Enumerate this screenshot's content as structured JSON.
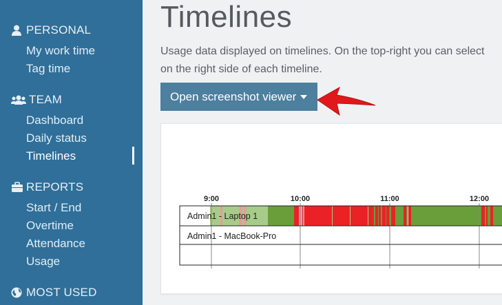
{
  "sidebar": {
    "sections": [
      {
        "label": "PERSONAL",
        "icon": "user-icon",
        "items": [
          "My work time",
          "Tag time"
        ]
      },
      {
        "label": "TEAM",
        "icon": "users-icon",
        "items": [
          "Dashboard",
          "Daily status",
          "Timelines"
        ]
      },
      {
        "label": "REPORTS",
        "icon": "briefcase-icon",
        "items": [
          "Start / End",
          "Overtime",
          "Attendance",
          "Usage"
        ]
      },
      {
        "label": "MOST USED",
        "icon": "globe-icon",
        "items": []
      }
    ],
    "active_item": "Timelines"
  },
  "main": {
    "title": "Timelines",
    "description_line1": "Usage data displayed on timelines. On the top-right you can select",
    "description_line2": "on the right side of each timeline.",
    "viewer_button": "Open screenshot viewer"
  },
  "timeline": {
    "hours": [
      "9:00",
      "10:00",
      "11:00",
      "12:00"
    ],
    "rows": [
      {
        "label": "Admin1 - Laptop 1"
      },
      {
        "label": "Admin1 - MacBook-Pro"
      },
      {
        "label": ""
      }
    ],
    "colors": {
      "active": "#6a9e3a",
      "idle": "#ea2226",
      "light": "#a7cc8a",
      "pink": "#e99a9a"
    }
  },
  "colors": {
    "sidebar": "#2f6f99",
    "button": "#4d7f9e",
    "arrow": "#e0181c"
  }
}
